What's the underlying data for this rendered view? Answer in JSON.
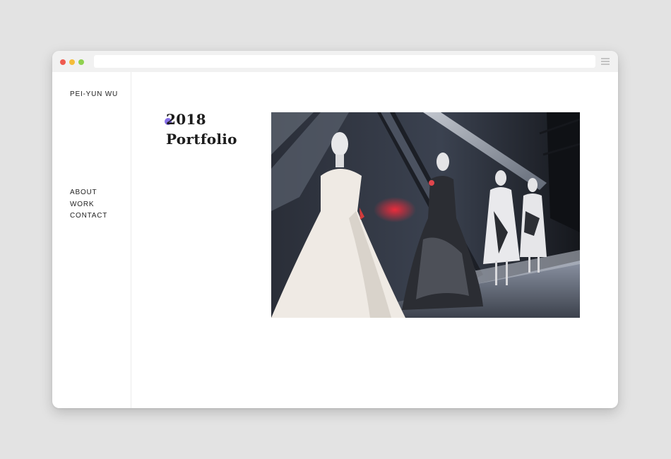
{
  "window": {
    "traffic_lights": {
      "close": "#ef5a4f",
      "minimize": "#f5bd3a",
      "maximize": "#8fd14f"
    },
    "menu_icon": "hamburger-icon"
  },
  "site": {
    "brand": "PEI-YUN WU",
    "nav": [
      "ABOUT",
      "WORK",
      "CONTACT"
    ]
  },
  "hero": {
    "title_line1": "2018",
    "title_line2": "Portfolio",
    "accent_color": "#7b62e6",
    "image_subject": "mannequins-in-gowns-exhibition-photo"
  }
}
